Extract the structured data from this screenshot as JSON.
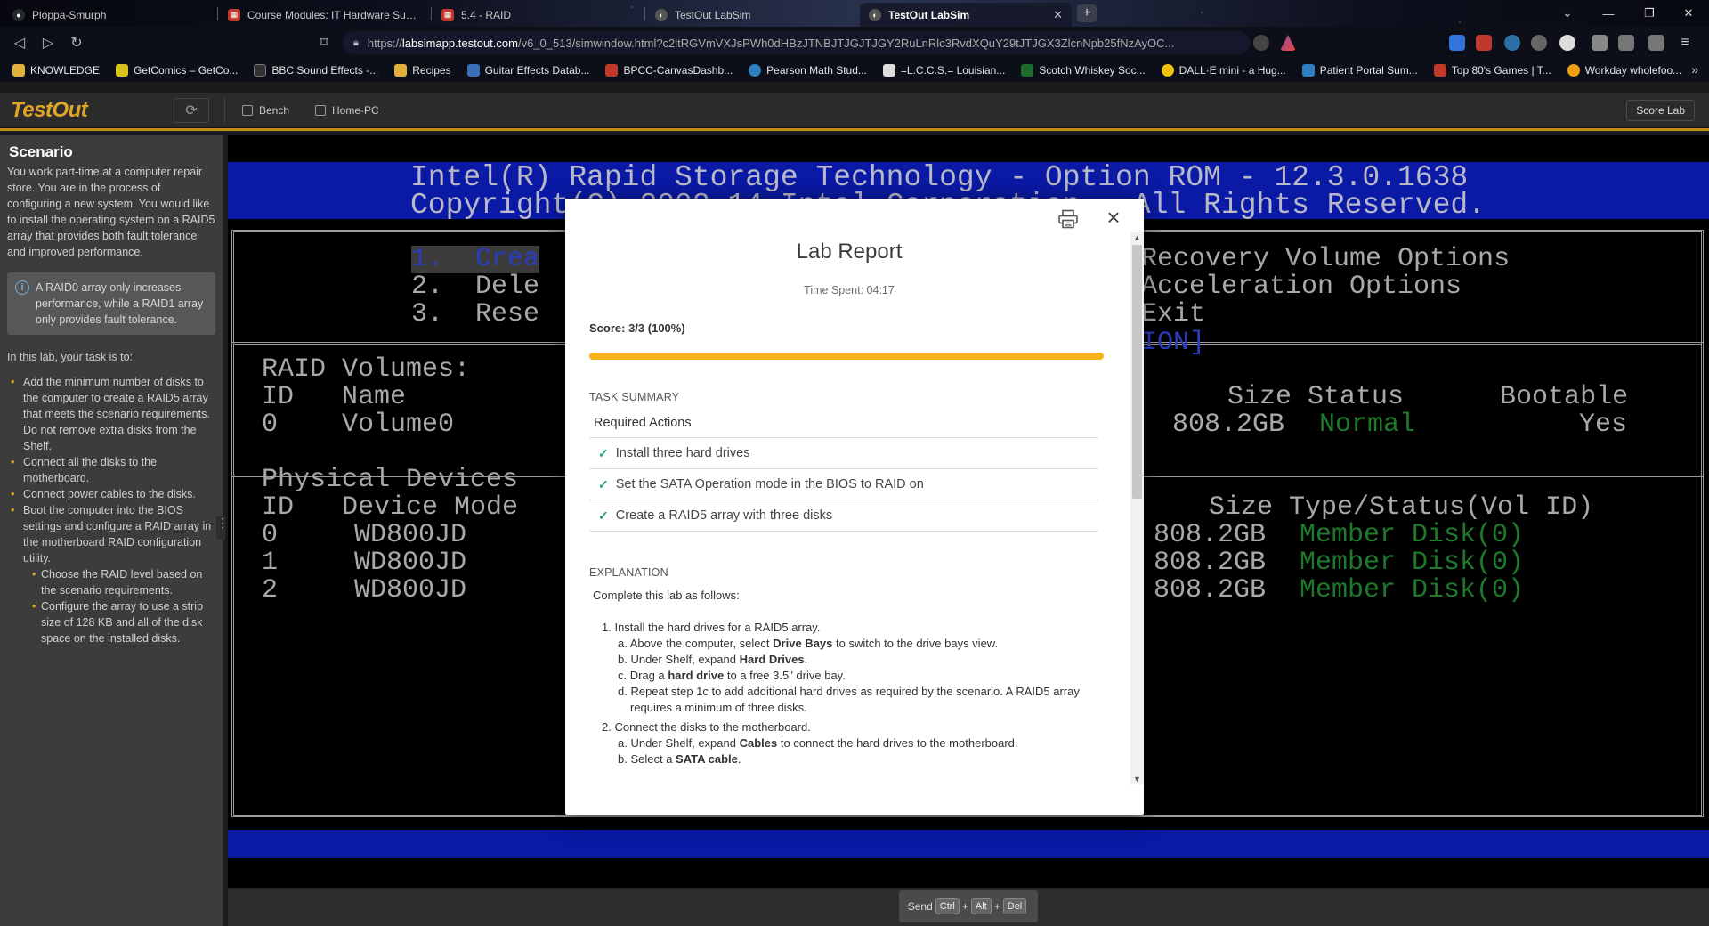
{
  "browser": {
    "tabs": [
      {
        "label": "Ploppa-Smurph",
        "fav": "#24292e",
        "active": false
      },
      {
        "label": "Course Modules: IT Hardware Suppor",
        "fav": "#c0392b",
        "active": false
      },
      {
        "label": "5.4 - RAID",
        "fav": "#c0392b",
        "active": false
      },
      {
        "label": "TestOut LabSim",
        "fav": "#3c3c3c",
        "active": false
      },
      {
        "label": "TestOut LabSim",
        "fav": "#3c3c3c",
        "active": true
      }
    ],
    "url_prefix": "https://",
    "url_domain": "labsimapp.testout.com",
    "url_path": "/v6_0_513/simwindow.html?c2ltRGVmVXJsPWh0dHBzJTNBJTJGJTJGY2RuLnRlc3RvdXQuY29tJTJGX3ZlcnNpb25fNzAyOC... ",
    "bookmarks": [
      {
        "label": "KNOWLEDGE",
        "color": "#e2b13c"
      },
      {
        "label": "GetComics – GetCo...",
        "color": "#d8c21c"
      },
      {
        "label": "BBC Sound Effects -...",
        "color": "#333"
      },
      {
        "label": "Recipes",
        "color": "#e2b13c"
      },
      {
        "label": "Guitar Effects Datab...",
        "color": "#3d6fb8"
      },
      {
        "label": "BPCC-CanvasDashb...",
        "color": "#c0392b"
      },
      {
        "label": "Pearson Math Stud...",
        "color": "#2d7fc1"
      },
      {
        "label": "=L.C.C.S.= Louisian...",
        "color": "#ddd"
      },
      {
        "label": "Scotch Whiskey Soc...",
        "color": "#1d6b2e"
      },
      {
        "label": "DALL·E mini - a Hug...",
        "color": "#f4c20d"
      },
      {
        "label": "Patient Portal Sum...",
        "color": "#2d7fc1"
      },
      {
        "label": "Top 80's Games | T...",
        "color": "#c0392b"
      },
      {
        "label": "Workday wholefoo...",
        "color": "#f39c12"
      }
    ]
  },
  "app": {
    "logo": "TestOut",
    "bench_label": "Bench",
    "homepc_label": "Home-PC",
    "score_lab_label": "Score Lab",
    "brand_color": "#e0a526"
  },
  "scenario": {
    "heading": "Scenario",
    "intro": "You work part-time at a computer repair store. You are in the process of configuring a new system. You would like to install the operating system on a RAID5 array that provides both fault tolerance and improved performance.",
    "note": "A RAID0 array only increases performance, while a RAID1 array only provides fault tolerance.",
    "task_intro": "In this lab, your task is to:",
    "tasks": [
      "Add the minimum number of disks to the computer to create a RAID5 array that meets the scenario requirements. Do not remove extra disks from the Shelf.",
      "Connect all the disks to the motherboard.",
      "Connect power cables to the disks.",
      "Boot the computer into the BIOS settings and configure a RAID array in the motherboard RAID configuration utility."
    ],
    "subtasks": [
      "Choose the RAID level based on the scenario requirements.",
      "Configure the array to use a strip size of 128 KB and all of the disk space on the installed disks."
    ]
  },
  "bios": {
    "header1": "Intel(R) Rapid Storage Technology - Option ROM - 12.3.0.1638",
    "header2": "Copyright(C) 2003-14 Intel Corporation.  All Rights Reserved.",
    "menu": [
      "1.  Crea",
      "2.  Dele",
      "3.  Rese"
    ],
    "menu_right": [
      "Recovery Volume Options",
      "Acceleration Options",
      "Exit"
    ],
    "menu_right_tail": "ION]",
    "raid_volumes_label": "RAID Volumes:",
    "vol_cols_left": "ID   Name",
    "vol_cols_right": "Size Status      Bootable",
    "vol_row_left": "0    Volume0",
    "vol_row_size": "808.2GB",
    "vol_row_status": "Normal",
    "vol_row_boot": "Yes",
    "phys_label": "Physical Devices",
    "phys_cols_left": "ID   Device Mode",
    "phys_cols_right": "Size Type/Status(Vol ID)",
    "phys_rows": [
      {
        "id": "0",
        "model": "WD800JD",
        "size": "808.2GB",
        "status": "Member Disk(0)"
      },
      {
        "id": "1",
        "model": "WD800JD",
        "size": "808.2GB",
        "status": "Member Disk(0)"
      },
      {
        "id": "2",
        "model": "WD800JD",
        "size": "808.2GB",
        "status": "Member Disk(0)"
      }
    ]
  },
  "sendbar": {
    "send": "Send",
    "k1": "Ctrl",
    "k2": "Alt",
    "k3": "Del",
    "plus": "+"
  },
  "report": {
    "title": "Lab Report",
    "time_spent": "Time Spent: 04:17",
    "score": "Score: 3/3 (100%)",
    "progress_fraction": 1.0,
    "task_summary_label": "TASK SUMMARY",
    "required_actions_label": "Required Actions",
    "actions": [
      "Install three hard drives",
      "Set the SATA Operation mode in the BIOS to RAID on",
      "Create a RAID5 array with three disks"
    ],
    "explanation_label": "EXPLANATION",
    "explanation_intro": "Complete this lab as follows:",
    "step1": "1. Install the hard drives for a RAID5 array.",
    "step1a_pre": "a. Above the computer, select ",
    "step1a_b": "Drive Bays",
    "step1a_post": " to switch to the drive bays view.",
    "step1b_pre": "b. Under Shelf, expand ",
    "step1b_b": "Hard Drives",
    "step1b_post": ".",
    "step1c_pre": "c. Drag a ",
    "step1c_b": "hard drive",
    "step1c_post": " to a free 3.5\" drive bay.",
    "step1d": "d. Repeat step 1c to add additional hard drives as required by the scenario. A RAID5 array requires a minimum of three disks.",
    "step2": "2. Connect the disks to the motherboard.",
    "step2a_pre": "a. Under Shelf, expand ",
    "step2a_b": "Cables",
    "step2a_post": " to connect the hard drives to the motherboard.",
    "step2b_pre": "b. Select a ",
    "step2b_b": "SATA cable",
    "step2b_post": "."
  }
}
